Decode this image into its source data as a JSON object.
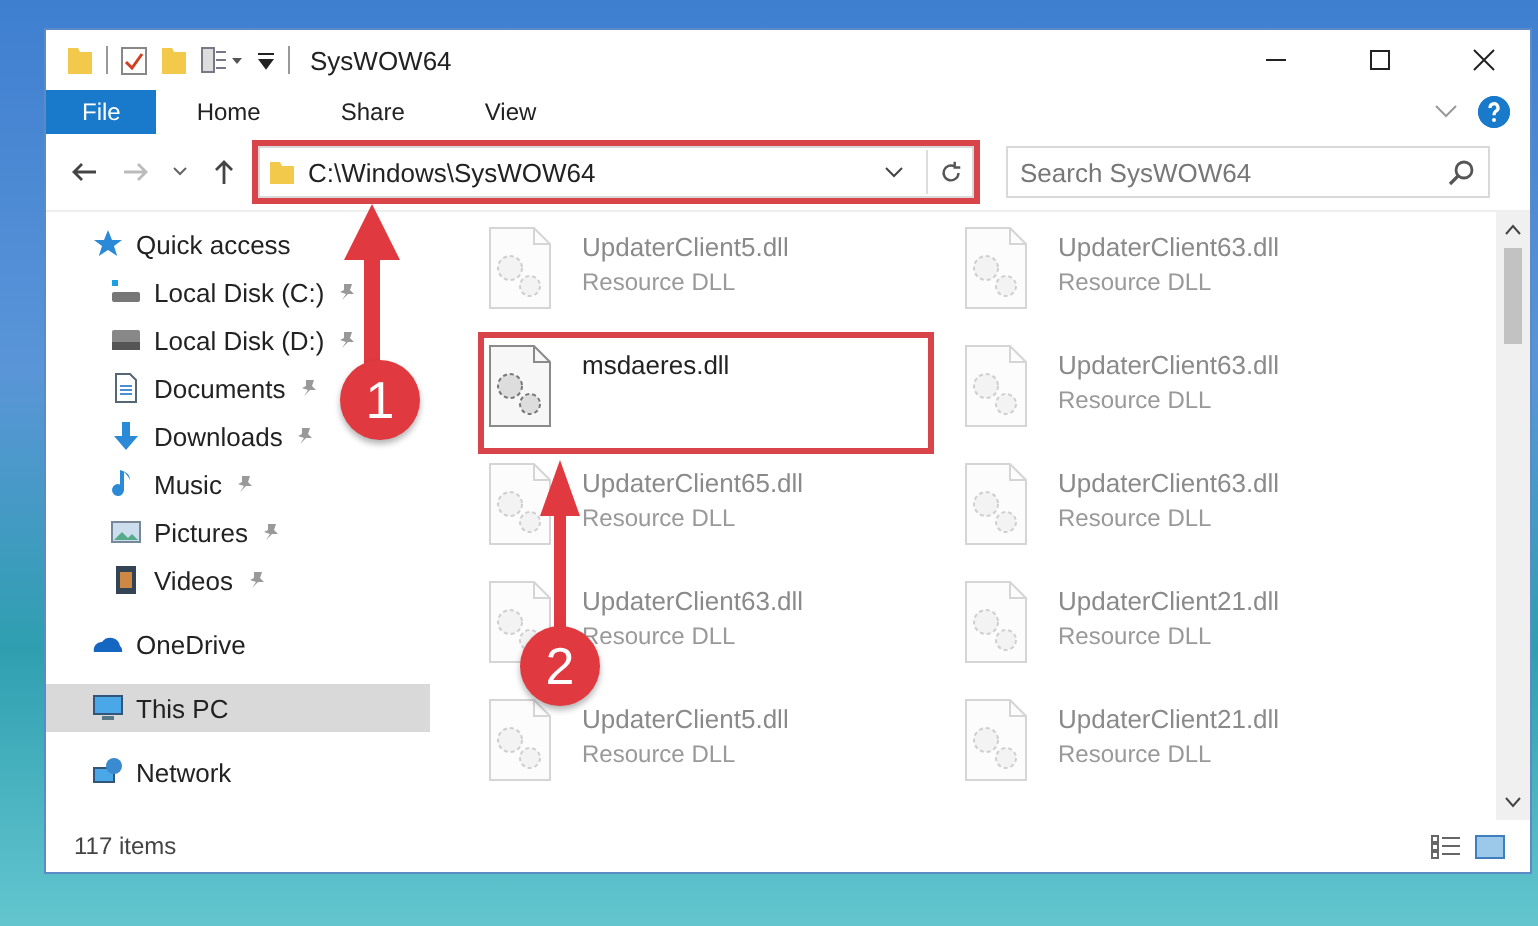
{
  "window": {
    "title": "SysWOW64"
  },
  "ribbon_tabs": [
    {
      "label": "File",
      "kind": "file"
    },
    {
      "label": "Home",
      "kind": "tab"
    },
    {
      "label": "Share",
      "kind": "tab"
    },
    {
      "label": "View",
      "kind": "tab"
    }
  ],
  "address": {
    "path": "C:\\Windows\\SysWOW64",
    "highlighted": true
  },
  "search": {
    "placeholder": "Search SysWOW64"
  },
  "nav": [
    {
      "label": "Quick access",
      "kind": "star",
      "selected": false,
      "children": [
        {
          "label": "Local Disk (C:)",
          "kind": "disk-c",
          "pinned": true,
          "selected": false
        },
        {
          "label": "Local Disk (D:)",
          "kind": "disk",
          "pinned": true,
          "selected": false
        },
        {
          "label": "Documents",
          "kind": "documents",
          "pinned": true,
          "selected": false
        },
        {
          "label": "Downloads",
          "kind": "downloads",
          "pinned": true,
          "selected": false
        },
        {
          "label": "Music",
          "kind": "music",
          "pinned": true,
          "selected": false
        },
        {
          "label": "Pictures",
          "kind": "pictures",
          "pinned": true,
          "selected": false
        },
        {
          "label": "Videos",
          "kind": "videos",
          "pinned": true,
          "selected": false
        }
      ]
    },
    {
      "label": "OneDrive",
      "kind": "cloud",
      "selected": false
    },
    {
      "label": "This PC",
      "kind": "pc",
      "selected": true
    },
    {
      "label": "Network",
      "kind": "network",
      "selected": false
    }
  ],
  "files": [
    {
      "name": "UpdaterClient5.dll",
      "type": "Resource DLL",
      "faded": true,
      "highlighted": false
    },
    {
      "name": "UpdaterClient63.dll",
      "type": "Resource DLL",
      "faded": true,
      "highlighted": false
    },
    {
      "name": "msdaeres.dll",
      "faded": false,
      "highlighted": true
    },
    {
      "name": "UpdaterClient63.dll",
      "type": "Resource DLL",
      "faded": true,
      "highlighted": false
    },
    {
      "name": "UpdaterClient65.dll",
      "type": "Resource DLL",
      "faded": true,
      "highlighted": false
    },
    {
      "name": "UpdaterClient63.dll",
      "type": "Resource DLL",
      "faded": true,
      "highlighted": false
    },
    {
      "name": "UpdaterClient63.dll",
      "type": "Resource DLL",
      "faded": true,
      "highlighted": false
    },
    {
      "name": "UpdaterClient21.dll",
      "type": "Resource DLL",
      "faded": true,
      "highlighted": false
    },
    {
      "name": "UpdaterClient5.dll",
      "type": "Resource DLL",
      "faded": true,
      "highlighted": false
    },
    {
      "name": "UpdaterClient21.dll",
      "type": "Resource DLL",
      "faded": true,
      "highlighted": false
    }
  ],
  "status_bar": {
    "count": "117 items"
  },
  "annotations": [
    {
      "number": "1"
    },
    {
      "number": "2"
    }
  ]
}
